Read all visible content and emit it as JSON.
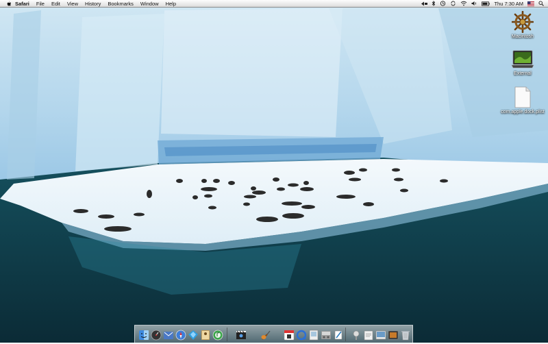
{
  "menubar": {
    "app_name": "Safari",
    "items": [
      "File",
      "Edit",
      "View",
      "History",
      "Bookmarks",
      "Window",
      "Help"
    ],
    "clock": "Thu 7:30 AM"
  },
  "desktop": {
    "icons": [
      {
        "label": "Macintosh",
        "icon": "ships-wheel-icon"
      },
      {
        "label": "External",
        "icon": "external-drive-icon"
      },
      {
        "label": "com.apple.dock.plist",
        "icon": "document-icon"
      }
    ]
  },
  "dock": {
    "apps": [
      "finder-icon",
      "dashboard-icon",
      "mail-icon",
      "safari-icon",
      "ichat-icon",
      "address-book-icon",
      "itunes-icon",
      "imovie-icon",
      "garageband-icon",
      "ical-icon",
      "quicktime-icon",
      "preview-icon",
      "system-preferences-icon",
      "textedit-icon"
    ],
    "others": [
      "downloads-stack-icon",
      "document-stack-icon",
      "photo-stack-icon",
      "screenshot-stack-icon",
      "trash-icon"
    ]
  }
}
